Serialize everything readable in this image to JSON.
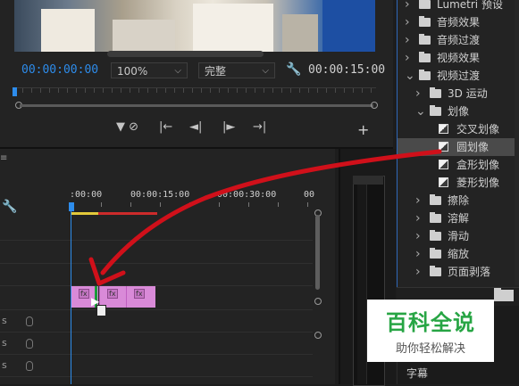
{
  "monitor": {
    "current_timecode": "00:00:00:00",
    "zoom": "100%",
    "quality": "完整",
    "duration_timecode": "00:00:15:00",
    "buttons": {
      "add_marker": "▼",
      "go_to_in": "|←",
      "step_back": "◄|",
      "step_forward": "|►",
      "go_to_out": "→|",
      "add": "+"
    }
  },
  "timeline": {
    "menu_glyph": "≡",
    "ruler_labels": [
      ":00:00",
      "00:00:15:00",
      "00:00:30:00",
      "00"
    ],
    "tracks": [
      {
        "label": "s"
      },
      {
        "label": "s"
      },
      {
        "label": "s"
      }
    ],
    "clips": [
      {
        "badge": "fx"
      },
      {
        "badge": "fx"
      },
      {
        "badge": "fx"
      }
    ]
  },
  "effects": {
    "items": [
      {
        "label": "Lumetri 预设",
        "level": 0,
        "expanded": false,
        "kind": "folder"
      },
      {
        "label": "音频效果",
        "level": 0,
        "expanded": false,
        "kind": "folder"
      },
      {
        "label": "音频过渡",
        "level": 0,
        "expanded": false,
        "kind": "folder"
      },
      {
        "label": "视频效果",
        "level": 0,
        "expanded": false,
        "kind": "folder"
      },
      {
        "label": "视频过渡",
        "level": 0,
        "expanded": true,
        "kind": "folder"
      },
      {
        "label": "3D 运动",
        "level": 1,
        "expanded": false,
        "kind": "folder"
      },
      {
        "label": "划像",
        "level": 1,
        "expanded": true,
        "kind": "folder"
      },
      {
        "label": "交叉划像",
        "level": 2,
        "kind": "preset"
      },
      {
        "label": "圆划像",
        "level": 2,
        "kind": "preset",
        "selected": true
      },
      {
        "label": "盒形划像",
        "level": 2,
        "kind": "preset"
      },
      {
        "label": "菱形划像",
        "level": 2,
        "kind": "preset"
      },
      {
        "label": "擦除",
        "level": 1,
        "expanded": false,
        "kind": "folder"
      },
      {
        "label": "溶解",
        "level": 1,
        "expanded": false,
        "kind": "folder"
      },
      {
        "label": "滑动",
        "level": 1,
        "expanded": false,
        "kind": "folder"
      },
      {
        "label": "缩放",
        "level": 1,
        "expanded": false,
        "kind": "folder"
      },
      {
        "label": "页面剥落",
        "level": 1,
        "expanded": false,
        "kind": "folder"
      }
    ],
    "selected_color": "#4a4a4a"
  },
  "lower_panel": {
    "caption_item": "字幕"
  },
  "watermark": {
    "title": "百科全说",
    "subtitle": "助你轻松解决"
  },
  "colors": {
    "timecode_blue": "#2d8ceb",
    "clip_pink": "#d98ad8",
    "annotation_red": "#d0101a",
    "watermark_green": "#27a544"
  }
}
